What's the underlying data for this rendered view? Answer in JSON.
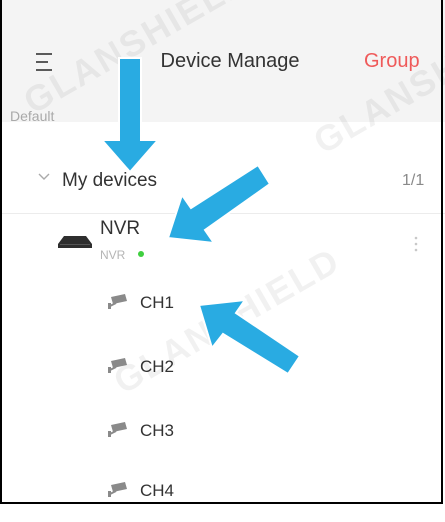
{
  "header": {
    "title": "Device Manage",
    "group_label": "Group",
    "section_label": "Default"
  },
  "group": {
    "name": "My devices",
    "count": "1/1"
  },
  "device": {
    "name": "NVR",
    "type": "NVR",
    "status_color": "#3fcf3f"
  },
  "channels": [
    {
      "label": "CH1"
    },
    {
      "label": "CH2"
    },
    {
      "label": "CH3"
    },
    {
      "label": "CH4"
    }
  ],
  "watermark": "GLANSHIELD",
  "colors": {
    "accent": "#ef5a5a",
    "arrow": "#29abe2",
    "online": "#3fcf3f"
  }
}
